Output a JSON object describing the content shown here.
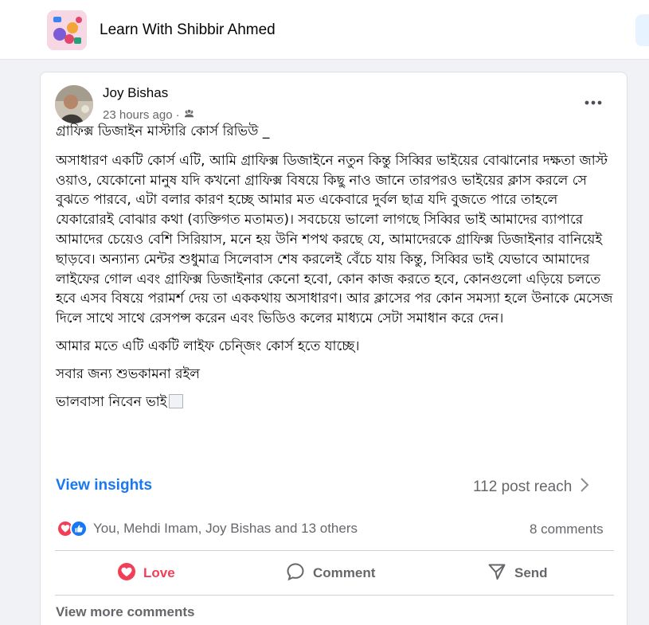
{
  "group": {
    "name": "Learn With Shibbir Ahmed"
  },
  "post": {
    "author": "Joy Bishas",
    "time": "23 hours ago",
    "separator": "·",
    "title_line": "গ্রাফিক্স ডিজাইন মাস্টারি কোর্স রিভিউ _",
    "paragraphs": [
      "অসাধারণ একটি কোর্স এটি, আমি গ্রাফিক্স ডিজাইনে নতুন কিন্তু সিব্বির ভাইয়ের বোঝানোর দক্ষতা জাস্ট ওয়াও, যেকোনো মানুষ যদি কখনো গ্রাফিক্স বিষয়ে কিছু নাও জানে তারপরও ভাইয়ের ক্লাস করলে সে বুঝতে পারবে, এটা বলার কারণ হচ্ছে আমার মত একেবারে দুর্বল ছাত্র যদি বুজতে পারে তাহলে যেকারোরই বোঝার কথা (ব্যক্তিগত মতামত)। সবচেয়ে ভালো লাগছে সিব্বির ভাই আমাদের ব্যাপারে আমাদের চেয়েও বেশি সিরিয়াস, মনে হয় উনি শপথ করছে যে, আমাদেরকে গ্রাফিক্স ডিজাইনার বানিয়েই ছাড়বে। অন্যান্য মেন্টর শুধুমাত্র সিলেবাস শেষ করলেই বেঁচে যায় কিন্তু, সিব্বির ভাই যেভাবে আমাদের লাইফের গোল এবং গ্রাফিক্স ডিজাইনার কেনো হবো, কোন কাজ করতে হবে, কোনগুলো এড়িয়ে চলতে হবে এসব বিষয়ে পরামর্শ দেয় তা এককথায় অসাধারণ। আর ক্লাসের পর কোন সমস্যা হলে উনাকে মেসেজ দিলে সাথে সাথে রেসপন্স করেন এবং ভিডিও কলের মাধ্যমে সেটা সমাধান করে দেন।",
      "আমার মতে এটি একটি লাইফ চেন্জিং কোর্স হতে যাচ্ছে।",
      "সবার জন্য শুভকামনা রইল",
      "ভালবাসা নিবেন ভাই"
    ]
  },
  "insights": {
    "link_label": "View insights",
    "reach_label": "112 post reach"
  },
  "reactions": {
    "summary": "You, Mehdi Imam, Joy Bishas and 13 others",
    "comments": "8 comments"
  },
  "actions": {
    "love": "Love",
    "comment": "Comment",
    "send": "Send"
  },
  "footer": {
    "view_more": "View more comments"
  },
  "colors": {
    "accent": "#1877f2",
    "love": "#f33e58",
    "secondary_text": "#65676b",
    "background": "#f0f2f5"
  },
  "icons": {
    "privacy": "group-privacy-icon",
    "more": "more-options-icon",
    "chevron": "chevron-right-icon",
    "love": "heart-icon",
    "like": "thumbs-up-icon",
    "comment": "speech-bubble-icon",
    "send": "send-arrow-icon"
  }
}
